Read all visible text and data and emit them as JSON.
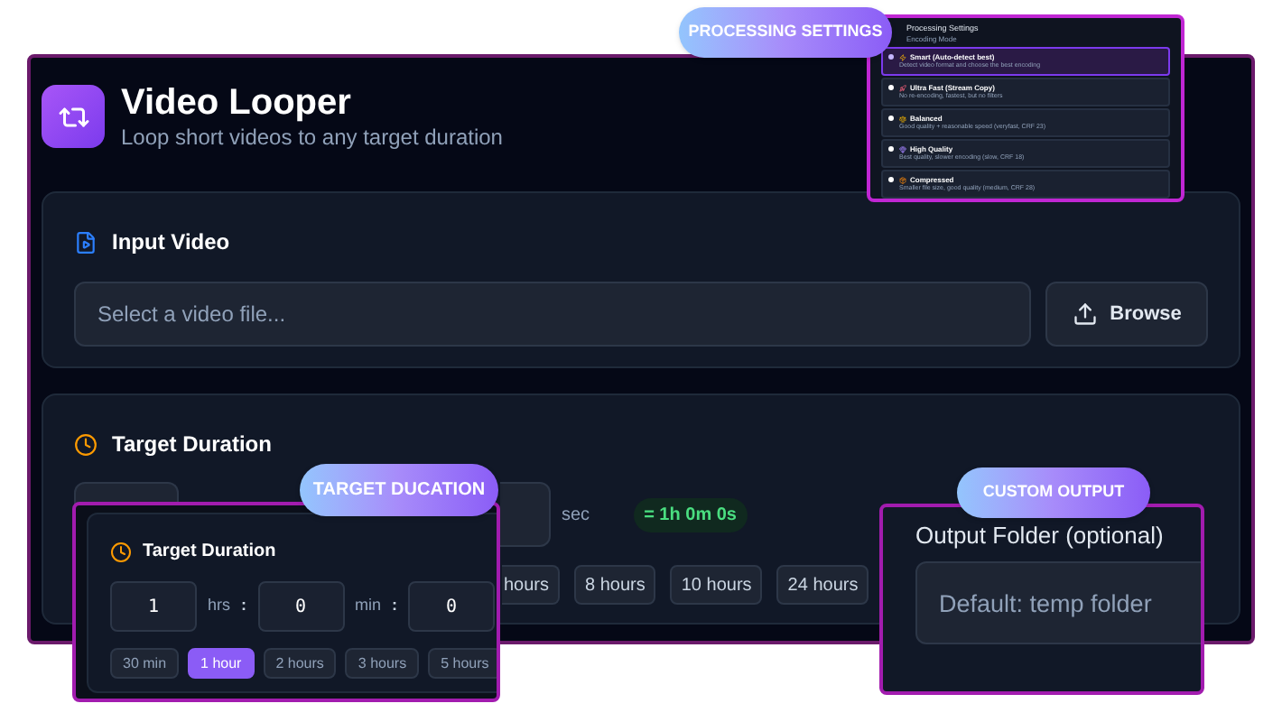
{
  "app": {
    "title": "Video Looper",
    "subtitle": "Loop short videos to any target duration"
  },
  "input_video": {
    "heading": "Input Video",
    "placeholder": "Select a video file...",
    "browse_button": "Browse"
  },
  "target_duration": {
    "heading": "Target Duration",
    "unit": "sec",
    "result": "= 1h 0m 0s",
    "presets": [
      {
        "label": "hours",
        "selected": false
      },
      {
        "label": "8 hours",
        "selected": false
      },
      {
        "label": "10 hours",
        "selected": false
      },
      {
        "label": "24 hours",
        "selected": false
      }
    ]
  },
  "processing_settings_callout": {
    "badge": "PROCESSING SETTINGS",
    "title": "Processing Settings",
    "label": "Encoding Mode",
    "options": [
      {
        "name": "Smart (Auto-detect best)",
        "description": "Detect video format and choose the best encoding",
        "selected": true
      },
      {
        "name": "Ultra Fast (Stream Copy)",
        "description": "No re-encoding, fastest, but no filters",
        "selected": false
      },
      {
        "name": "Balanced",
        "description": "Good quality + reasonable speed (veryfast, CRF 23)",
        "selected": false
      },
      {
        "name": "High Quality",
        "description": "Best quality, slower encoding (slow, CRF 18)",
        "selected": false
      },
      {
        "name": "Compressed",
        "description": "Smaller file size, good quality (medium, CRF 28)",
        "selected": false
      }
    ]
  },
  "target_duration_callout": {
    "badge": "TARGET DUCATION",
    "heading": "Target Duration",
    "fields": [
      {
        "value": "1",
        "unit": "hrs",
        "separator": ":"
      },
      {
        "value": "0",
        "unit": "min",
        "separator": ":"
      },
      {
        "value": "0"
      }
    ],
    "presets": [
      {
        "label": "30 min",
        "selected": false
      },
      {
        "label": "1 hour",
        "selected": true
      },
      {
        "label": "2 hours",
        "selected": false
      },
      {
        "label": "3 hours",
        "selected": false
      },
      {
        "label": "5 hours",
        "selected": false
      }
    ]
  },
  "custom_output_callout": {
    "badge": "CUSTOM OUTPUT",
    "label": "Output Folder (optional)",
    "placeholder": "Default: temp folder"
  }
}
